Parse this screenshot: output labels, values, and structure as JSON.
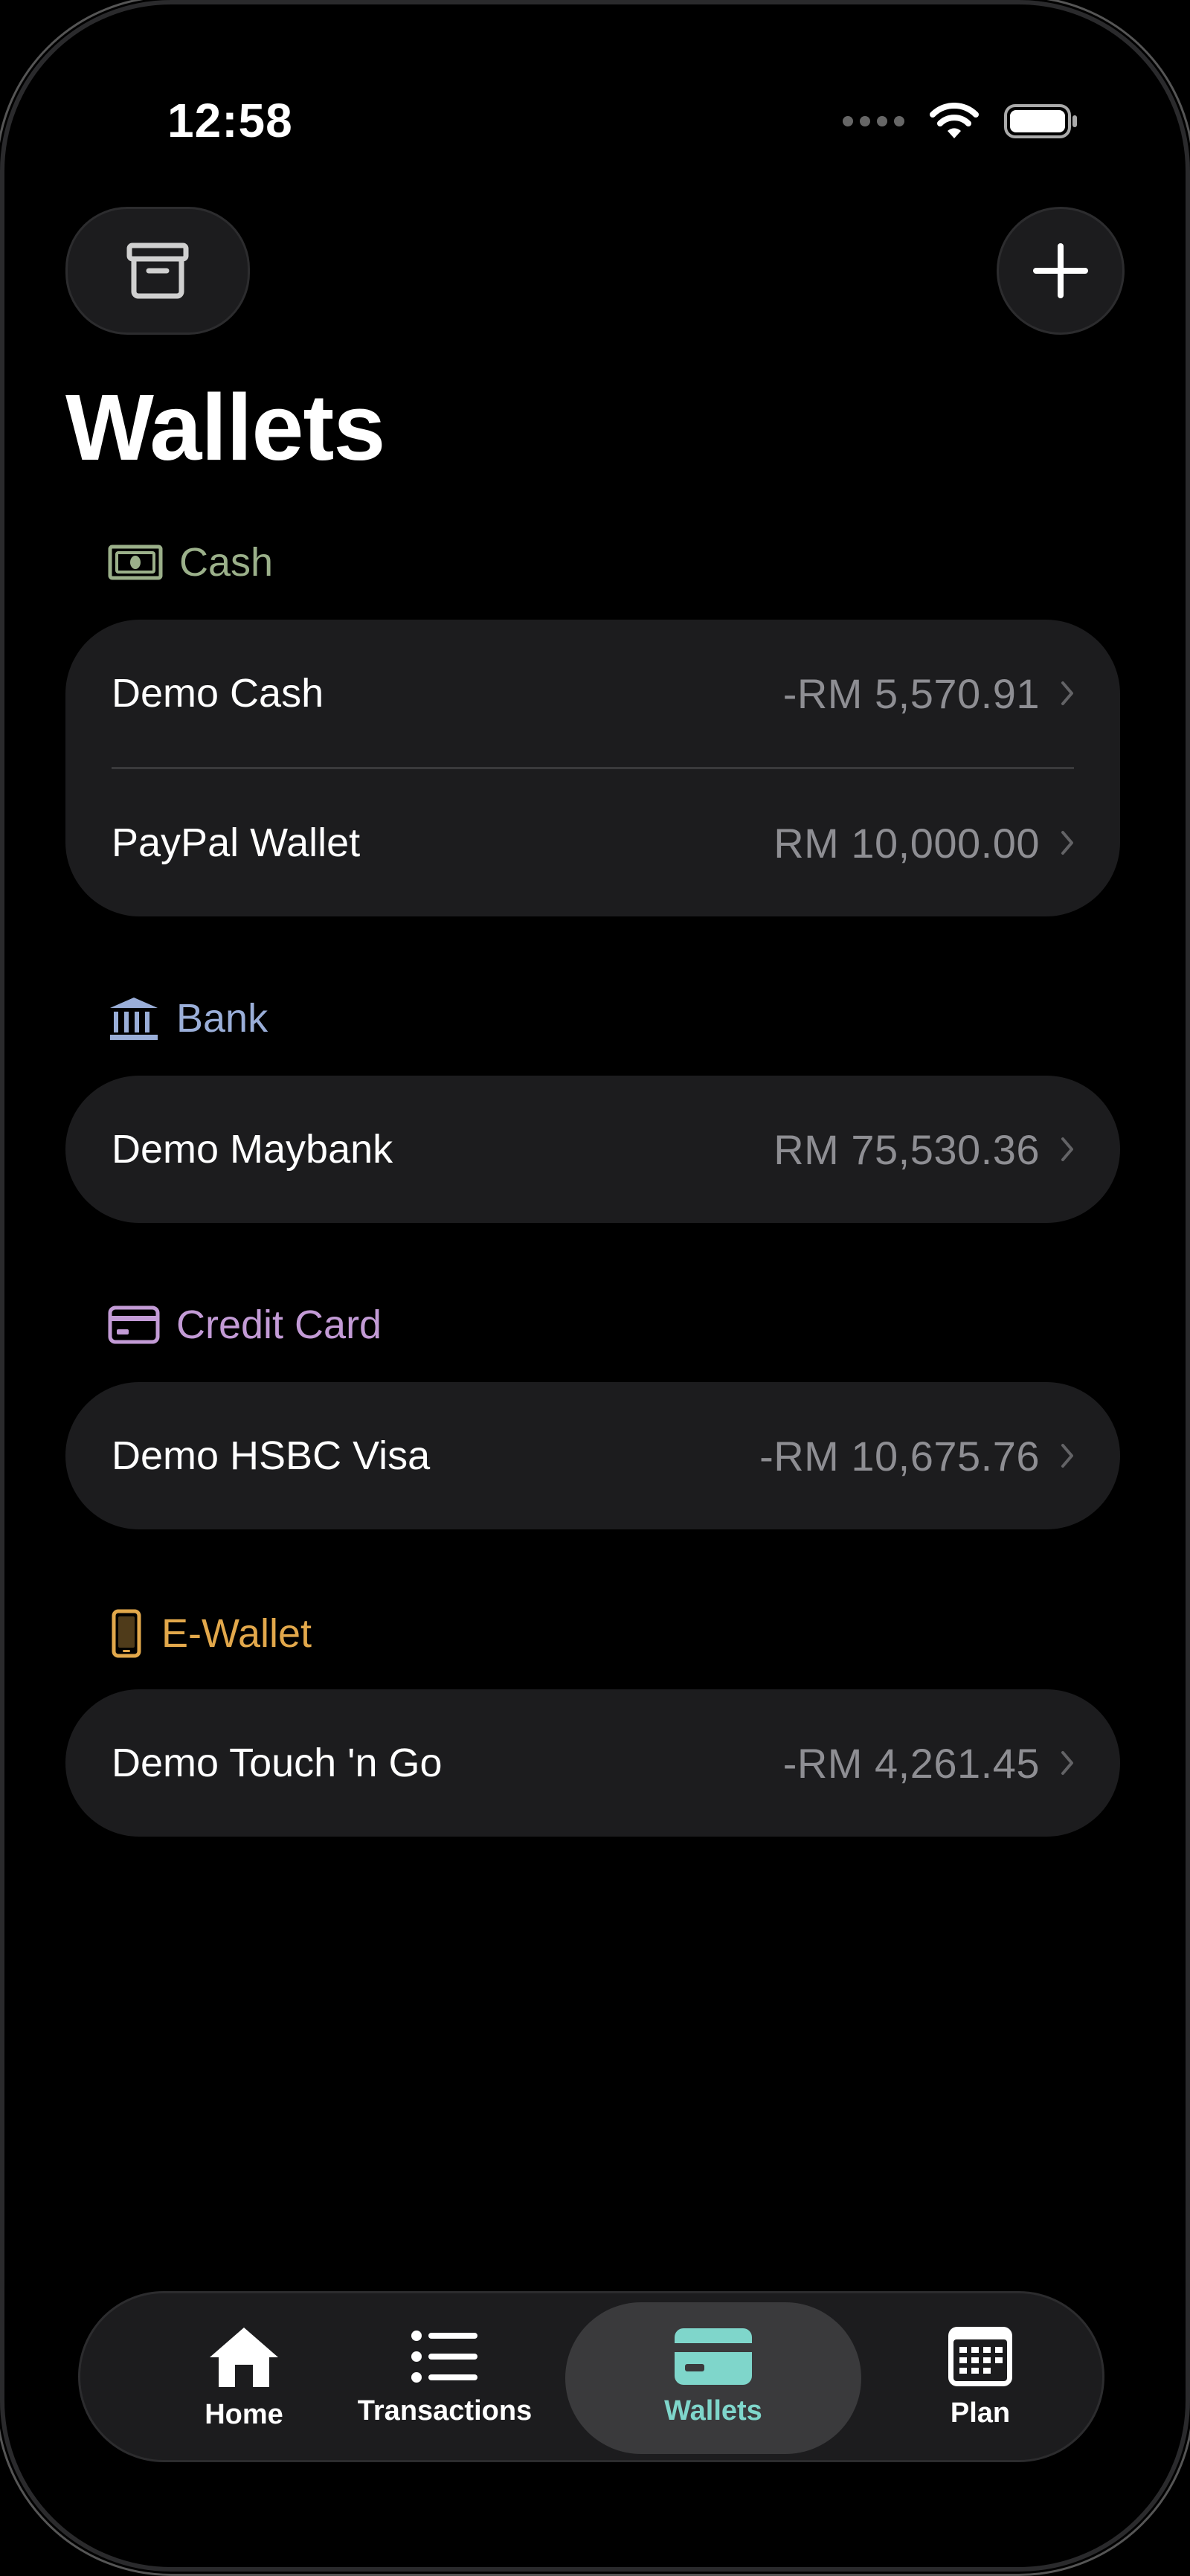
{
  "status_bar": {
    "time": "12:58"
  },
  "header": {
    "title": "Wallets"
  },
  "sections": [
    {
      "label": "Cash",
      "color": "#9bb08a",
      "icon": "banknote-icon",
      "wallets": [
        {
          "name": "Demo Cash",
          "amount": "-RM 5,570.91"
        },
        {
          "name": "PayPal Wallet",
          "amount": "RM 10,000.00"
        }
      ]
    },
    {
      "label": "Bank",
      "color": "#9aaed8",
      "icon": "bank-icon",
      "wallets": [
        {
          "name": "Demo Maybank",
          "amount": "RM 75,530.36"
        }
      ]
    },
    {
      "label": "Credit Card",
      "color": "#c39bd6",
      "icon": "credit-card-icon",
      "wallets": [
        {
          "name": "Demo HSBC Visa",
          "amount": "-RM 10,675.76"
        }
      ]
    },
    {
      "label": "E-Wallet",
      "color": "#e2a84b",
      "icon": "phone-icon",
      "wallets": [
        {
          "name": "Demo Touch 'n Go",
          "amount": "-RM 4,261.45"
        }
      ]
    }
  ],
  "tabbar": {
    "items": [
      {
        "label": "Home",
        "icon": "house-icon"
      },
      {
        "label": "Transactions",
        "icon": "list-icon"
      },
      {
        "label": "Wallets",
        "icon": "wallet-card-icon",
        "active": true
      },
      {
        "label": "Plan",
        "icon": "calendar-icon"
      }
    ],
    "accent": "#7fd6cb"
  }
}
